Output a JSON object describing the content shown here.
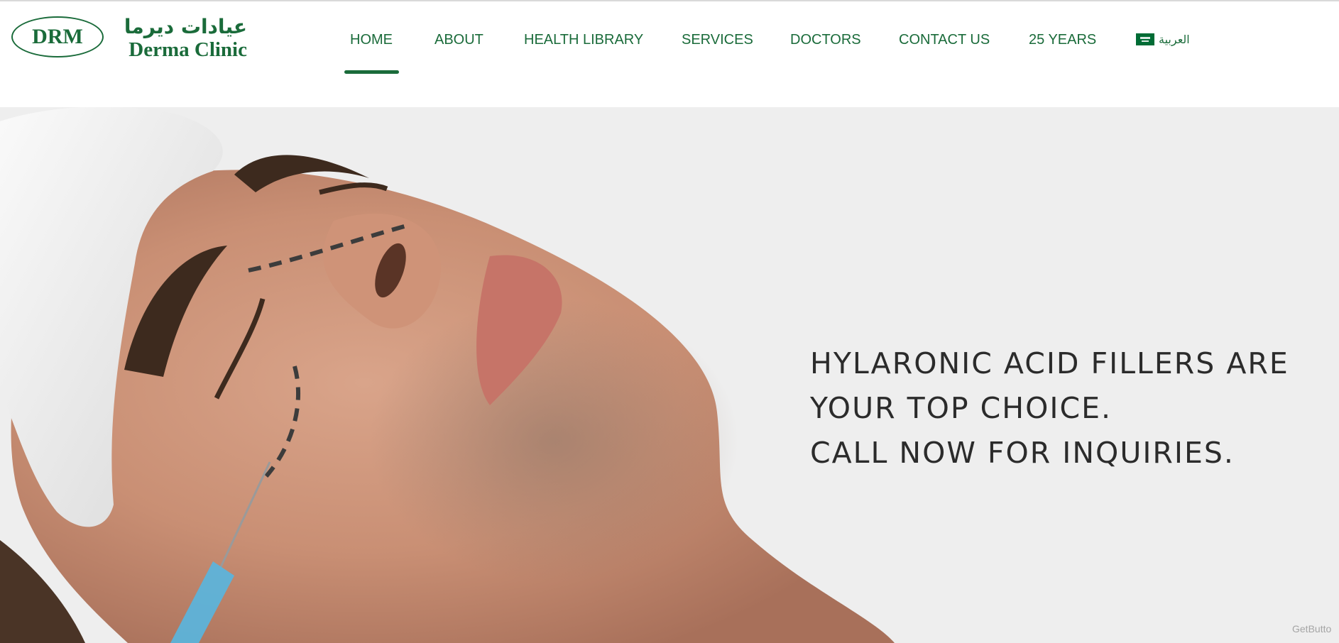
{
  "brand": {
    "logo_mark": "DRM",
    "arabic_name": "عيادات ديرما",
    "english_name": "Derma Clinic"
  },
  "nav": {
    "active": "HOME",
    "items": [
      {
        "label": "HOME"
      },
      {
        "label": "ABOUT"
      },
      {
        "label": "HEALTH LIBRARY"
      },
      {
        "label": "SERVICES"
      },
      {
        "label": "DOCTORS"
      },
      {
        "label": "CONTACT US"
      },
      {
        "label": "25 YEARS"
      }
    ],
    "language_label": "العربية",
    "language_icon": "saudi-flag-icon"
  },
  "hero": {
    "lines": [
      "HYLARONIC ACID FILLERS ARE",
      "YOUR TOP CHOICE.",
      "CALL NOW FOR INQUIRIES."
    ],
    "image_subject": "man receiving filler injection"
  },
  "widget": {
    "label": "GetButto"
  },
  "colors": {
    "brand_green": "#1a6b3a",
    "hero_background": "#eeeeee",
    "hero_text": "#2b2b2b"
  }
}
